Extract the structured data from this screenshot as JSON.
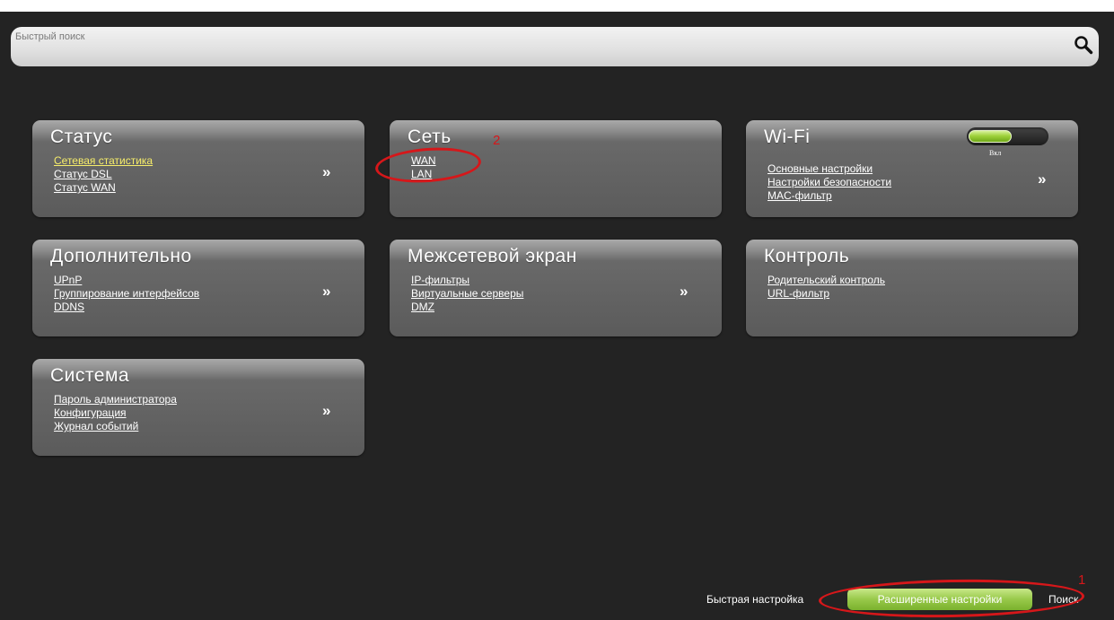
{
  "search": {
    "placeholder": "Быстрый поиск"
  },
  "cards": [
    {
      "title": "Статус",
      "links": [
        "Сетевая статистика",
        "Статус DSL",
        "Статус WAN"
      ],
      "more": "»"
    },
    {
      "title": "Сеть",
      "links": [
        "WAN",
        "LAN"
      ]
    },
    {
      "title": "Wi-Fi",
      "links": [
        "Основные настройки",
        "Настройки безопасности",
        "MAC-фильтр"
      ],
      "more": "»",
      "toggle_label": "Вкл"
    },
    {
      "title": "Дополнительно",
      "links": [
        "UPnP",
        "Группирование интерфейсов",
        "DDNS"
      ],
      "more": "»"
    },
    {
      "title": "Межсетевой экран",
      "links": [
        "IP-фильтры",
        "Виртуальные серверы",
        "DMZ"
      ],
      "more": "»"
    },
    {
      "title": "Контроль",
      "links": [
        "Родительский контроль",
        "URL-фильтр"
      ]
    },
    {
      "title": "Система",
      "links": [
        "Пароль администратора",
        "Конфигурация",
        "Журнал событий"
      ],
      "more": "»"
    }
  ],
  "annotations": {
    "one": "1",
    "two": "2"
  },
  "footer": {
    "quick_setup": "Быстрая настройка",
    "advanced": "Расширенные настройки",
    "search": "Поиск"
  },
  "colors": {
    "background": "#232323",
    "active_link": "#f6ed6a",
    "annotation": "#d6171a",
    "button": "#98c94a"
  },
  "icons": {
    "search": "magnifier-icon"
  }
}
